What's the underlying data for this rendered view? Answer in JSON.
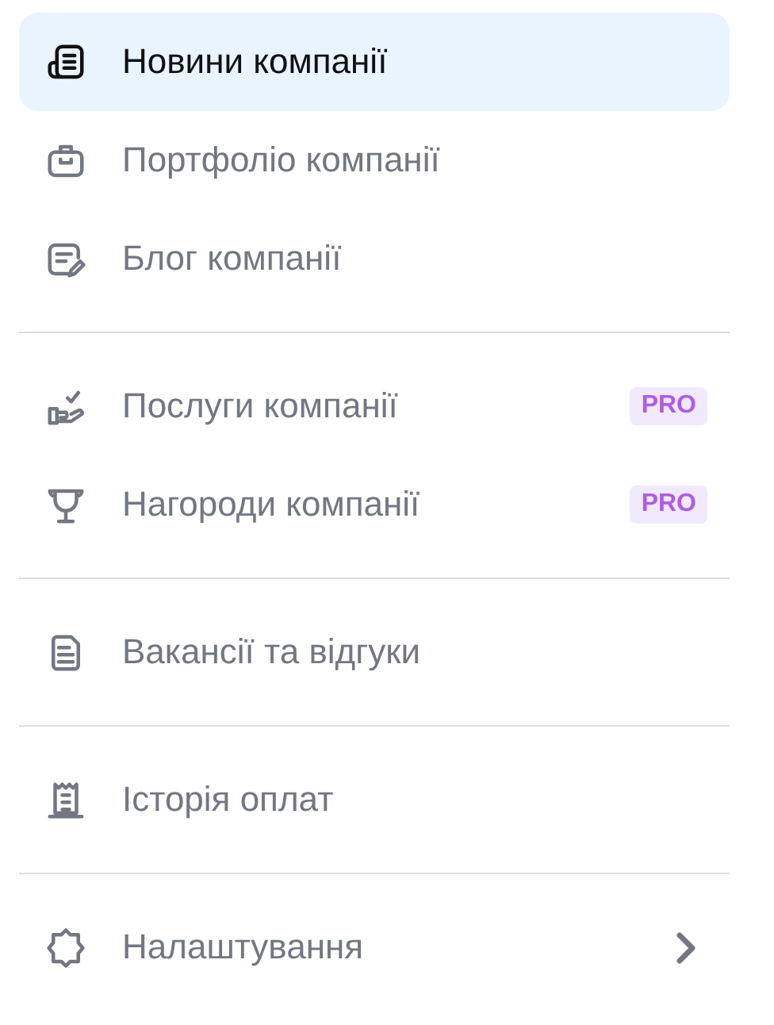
{
  "sidebar": {
    "sections": [
      {
        "items": [
          {
            "label": "Новини компанії",
            "selected": true,
            "submenu": false
          },
          {
            "label": "Портфоліо компанії",
            "selected": false,
            "submenu": false
          },
          {
            "label": "Блог компанії",
            "selected": false,
            "submenu": false
          }
        ]
      },
      {
        "items": [
          {
            "label": "Послуги компанії",
            "selected": false,
            "submenu": false,
            "badge": "PRO"
          },
          {
            "label": "Нагороди компанії",
            "selected": false,
            "submenu": false,
            "badge": "PRO"
          }
        ]
      },
      {
        "items": [
          {
            "label": "Вакансії та відгуки",
            "selected": false,
            "submenu": false
          }
        ]
      },
      {
        "items": [
          {
            "label": "Історія оплат",
            "selected": false,
            "submenu": false
          }
        ]
      },
      {
        "items": [
          {
            "label": "Налаштування",
            "selected": false,
            "submenu": true
          }
        ]
      }
    ]
  }
}
